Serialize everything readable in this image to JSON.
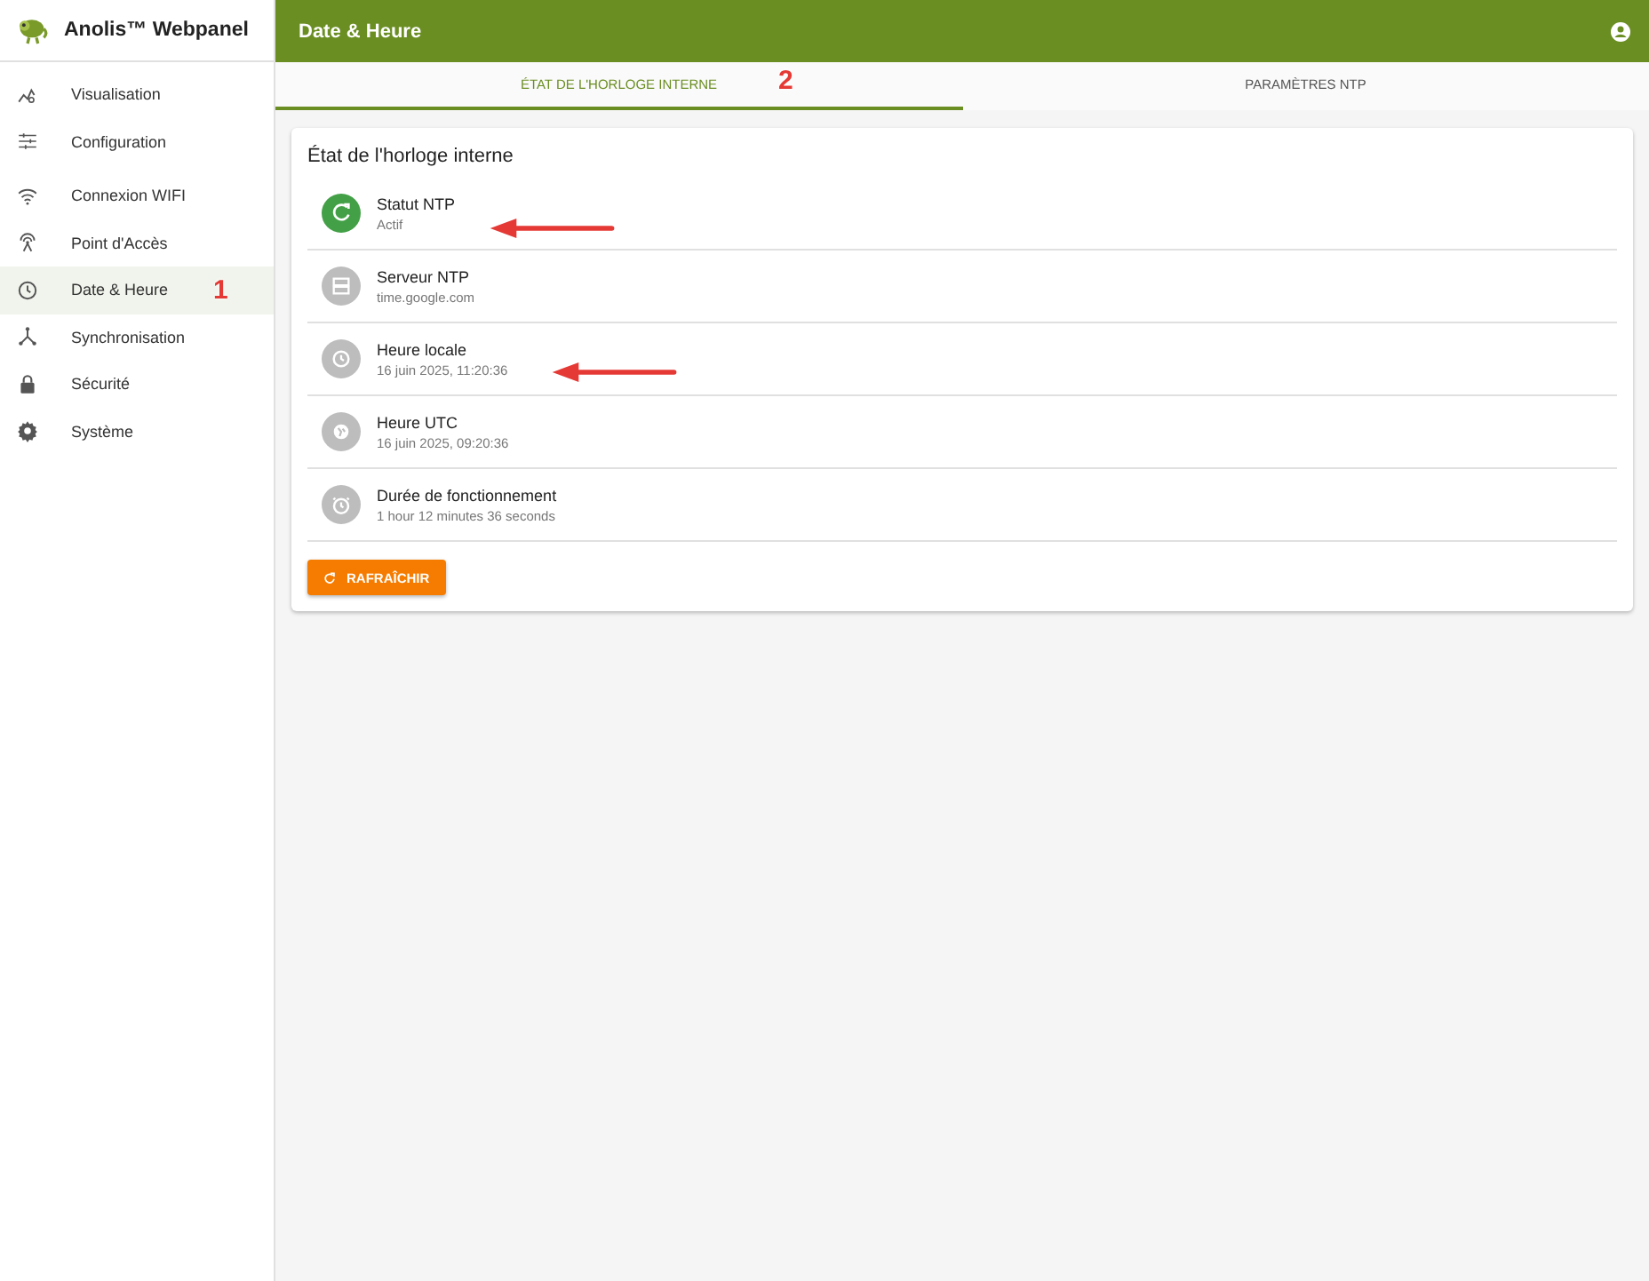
{
  "app": {
    "title": "Anolis™ Webpanel"
  },
  "sidebar": {
    "items": [
      {
        "label": "Visualisation",
        "selected": false
      },
      {
        "label": "Configuration",
        "selected": false
      },
      {
        "label": "Connexion WIFI",
        "selected": false
      },
      {
        "label": "Point d'Accès",
        "selected": false
      },
      {
        "label": "Date & Heure",
        "selected": true
      },
      {
        "label": "Synchronisation",
        "selected": false
      },
      {
        "label": "Sécurité",
        "selected": false
      },
      {
        "label": "Système",
        "selected": false
      }
    ]
  },
  "header": {
    "title": "Date & Heure"
  },
  "tabs": [
    {
      "label": "ÉTAT DE L'HORLOGE INTERNE",
      "selected": true
    },
    {
      "label": "PARAMÈTRES NTP",
      "selected": false
    }
  ],
  "card": {
    "title": "État de l'horloge interne",
    "items": [
      {
        "label": "Statut NTP",
        "value": "Actif",
        "active": true
      },
      {
        "label": "Serveur NTP",
        "value": "time.google.com",
        "active": false
      },
      {
        "label": "Heure locale",
        "value": "16 juin 2025, 11:20:36",
        "active": false
      },
      {
        "label": "Heure UTC",
        "value": "16 juin 2025, 09:20:36",
        "active": false
      },
      {
        "label": "Durée de fonctionnement",
        "value": "1 hour 12 minutes 36 seconds",
        "active": false
      }
    ],
    "button": "RAFRAÎCHIR"
  },
  "annotations": [
    {
      "kind": "number",
      "text": "1"
    },
    {
      "kind": "number",
      "text": "2"
    },
    {
      "kind": "arrow"
    },
    {
      "kind": "arrow"
    }
  ]
}
